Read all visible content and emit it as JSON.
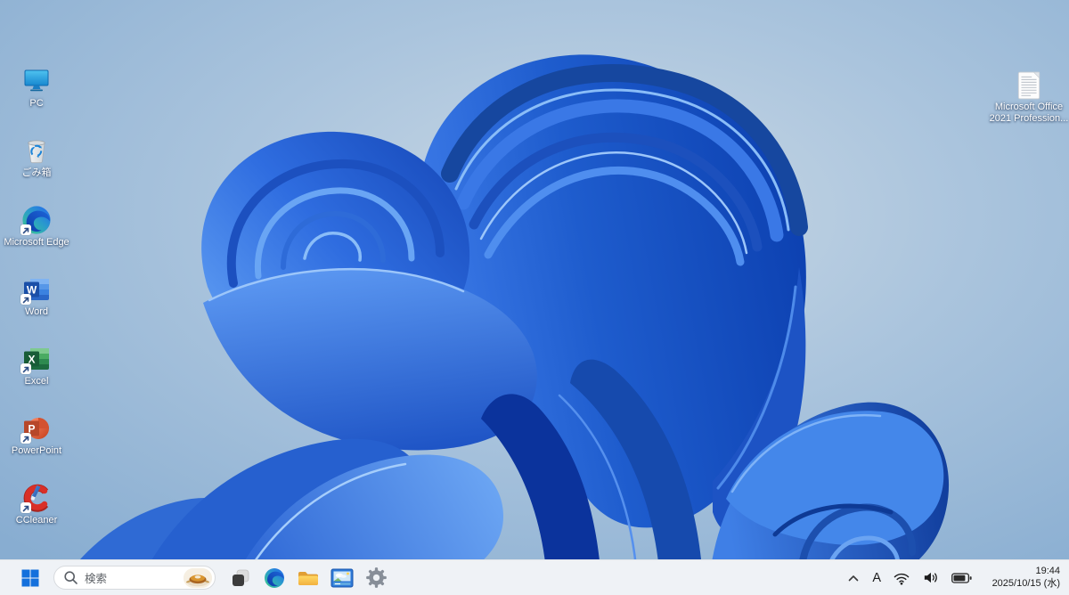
{
  "desktop": {
    "icons": [
      {
        "label": "PC"
      },
      {
        "label": "ごみ箱"
      },
      {
        "label": "Microsoft Edge"
      },
      {
        "label": "Word"
      },
      {
        "label": "Excel"
      },
      {
        "label": "PowerPoint"
      },
      {
        "label": "CCleaner"
      }
    ],
    "office_file": {
      "line1": "Microsoft Office",
      "line2": "2021 Profession..."
    }
  },
  "taskbar": {
    "search_placeholder": "検索",
    "tray": {
      "ime_mode": "A",
      "time": "19:44",
      "date": "2025/10/15 (水)"
    }
  },
  "icons_semantics": {
    "start": "windows-logo",
    "search": "magnifier",
    "search_highlight": "pie-photo",
    "task_view": "overlapping-squares",
    "edge": "edge-swirl",
    "file_explorer": "yellow-folder",
    "image_viewer": "framed-photo",
    "settings": "gear",
    "tray_icons": [
      "chevron-up",
      "ime-a",
      "wifi",
      "speaker",
      "battery"
    ]
  },
  "colors": {
    "taskbar_bg": "#eff2f6",
    "search_border": "#d7dade",
    "start_blue": "#1470dc",
    "sky_light": "#c7d7e5",
    "sky_dark": "#8bafd2",
    "bloom_deep": "#0c40b0",
    "bloom_mid": "#2f6fdf",
    "bloom_light": "#6fa9f5"
  }
}
